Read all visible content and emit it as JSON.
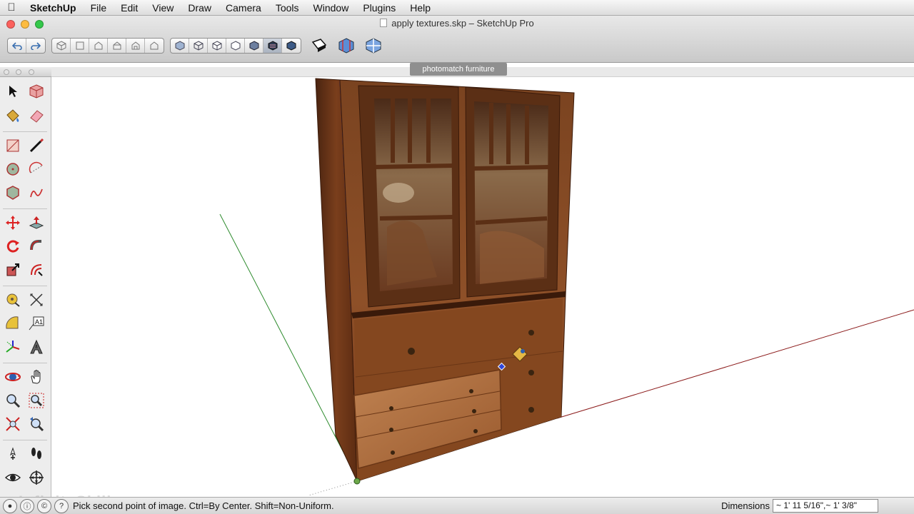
{
  "menubar": {
    "app_name": "SketchUp",
    "items": [
      "File",
      "Edit",
      "View",
      "Draw",
      "Camera",
      "Tools",
      "Window",
      "Plugins",
      "Help"
    ]
  },
  "window": {
    "title": "apply textures.skp – SketchUp Pro"
  },
  "toolbar": {
    "groups": [
      [
        "undo-icon",
        "redo-icon"
      ],
      [
        "view-iso-icon",
        "view-top-icon",
        "view-front-icon",
        "view-right-icon",
        "view-back-icon",
        "view-left-icon"
      ],
      [
        "style-xray-icon",
        "style-wireframe-icon",
        "style-hidden-line-icon",
        "style-shaded-icon",
        "style-shaded-texture-icon",
        "style-monochrome-icon",
        "style-back-edges-icon"
      ]
    ],
    "active_style": "style-monochrome-icon",
    "extra_buttons": [
      "section-plane-icon",
      "section-cut-icon",
      "section-display-icon"
    ]
  },
  "scene_tab": {
    "label": "photomatch furniture"
  },
  "tools": [
    "select-icon",
    "make-component-icon",
    "paint-bucket-icon",
    "eraser-icon",
    "rectangle-icon",
    "line-icon",
    "circle-icon",
    "arc-icon",
    "polygon-icon",
    "freehand-icon",
    "move-icon",
    "push-pull-icon",
    "rotate-icon",
    "follow-me-icon",
    "scale-icon",
    "offset-icon",
    "tape-measure-icon",
    "dimension-icon",
    "protractor-icon",
    "text-icon",
    "axes-icon",
    "3d-text-icon",
    "orbit-icon",
    "pan-icon",
    "zoom-icon",
    "zoom-window-icon",
    "zoom-extents-icon",
    "previous-view-icon",
    "position-camera-icon",
    "walk-icon",
    "look-around-icon",
    "section-plane-tool-icon"
  ],
  "watermark": "InfiniteSkills.com",
  "status": {
    "message": "Pick second point of image. Ctrl=By Center. Shift=Non-Uniform.",
    "dimensions_label": "Dimensions",
    "dimensions_value": "~ 1' 11 5/16\",~ 1' 3/8\""
  },
  "colors": {
    "axis_red": "#8b1a1a",
    "axis_green": "#2e8b2e",
    "axis_blue": "#2b2bb0",
    "wood_dark": "#5a2e14",
    "wood_mid": "#8a4a22",
    "wood_light": "#b87a45"
  }
}
